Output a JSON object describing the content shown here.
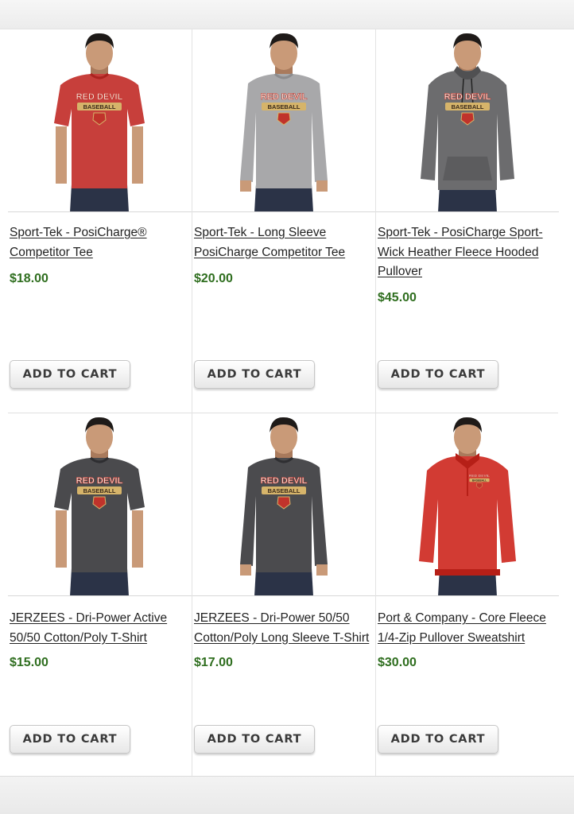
{
  "products": [
    {
      "title": "Sport-Tek - PosiCharge®\nCompetitor Tee",
      "price": "$18.00",
      "button_label": "ADD TO CART",
      "image": {
        "garment": "tee",
        "color": "#c73f3b",
        "graphic_text": "RED DEVIL",
        "graphic_subtext": "BASEBALL"
      }
    },
    {
      "title": "Sport-Tek - Long Sleeve\nPosiCharge Competitor Tee",
      "price": "$20.00",
      "button_label": "ADD TO CART",
      "image": {
        "garment": "longsleeve",
        "color": "#a8a8aa",
        "graphic_text": "RED DEVIL",
        "graphic_subtext": "BASEBALL"
      }
    },
    {
      "title": "Sport-Tek - PosiCharge Sport-\nWick Heather Fleece Hooded\nPullover",
      "price": "$45.00",
      "button_label": "ADD TO CART",
      "image": {
        "garment": "hoodie",
        "color": "#6c6c6e",
        "graphic_text": "RED DEVIL",
        "graphic_subtext": "BASEBALL"
      }
    },
    {
      "title": "JERZEES - Dri-Power Active\n50/50 Cotton/Poly T-Shirt",
      "price": "$15.00",
      "button_label": "ADD TO CART",
      "image": {
        "garment": "tee",
        "color": "#4a4a4d",
        "graphic_text": "RED DEVIL",
        "graphic_subtext": "BASEBALL"
      }
    },
    {
      "title": "JERZEES - Dri-Power 50/50\nCotton/Poly Long Sleeve T-Shirt",
      "price": "$17.00",
      "button_label": "ADD TO CART",
      "image": {
        "garment": "longsleeve",
        "color": "#4b4b4e",
        "graphic_text": "RED DEVIL",
        "graphic_subtext": "BASEBALL"
      }
    },
    {
      "title": "Port & Company - Core Fleece\n1/4-Zip Pullover Sweatshirt",
      "price": "$30.00",
      "button_label": "ADD TO CART",
      "image": {
        "garment": "quarterzip",
        "color": "#d23b33",
        "graphic_text": "RED DEVIL",
        "graphic_subtext": "BASEBALL"
      }
    }
  ],
  "colors": {
    "price": "#2f6e1f",
    "logo_red": "#c0332b",
    "logo_gold": "#d6b46a"
  }
}
